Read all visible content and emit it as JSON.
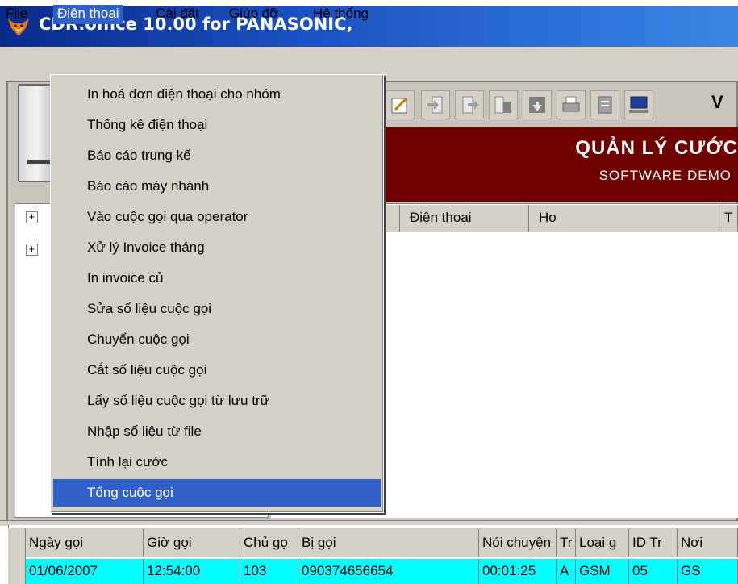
{
  "window": {
    "title": "CDR.office 10.00 for PANASONIC,"
  },
  "menubar": {
    "items": [
      {
        "label": "File"
      },
      {
        "label": "Điện thoại"
      },
      {
        "label": "Cài đặt"
      },
      {
        "label": "Giúp đỡ"
      },
      {
        "label": "Hệ thống"
      }
    ]
  },
  "dropdown": {
    "items": [
      {
        "label": "In hoá đơn điện thoại cho nhóm"
      },
      {
        "label": "Thống kê điện thoại"
      },
      {
        "label": "Báo cáo trung kế"
      },
      {
        "label": "Báo cáo máy nhánh"
      },
      {
        "label": "Vào cuộc gọi qua operator"
      },
      {
        "label": "Xử lý Invoice tháng"
      },
      {
        "label": "In invoice củ"
      },
      {
        "label": "Sửa số liệu cuộc gọi"
      },
      {
        "label": "Chuyển cuộc gọi"
      },
      {
        "label": "Cắt số liệu cuộc gọi"
      },
      {
        "label": "Lấy số liệu cuộc gọi từ lưu trữ"
      },
      {
        "label": "Nhập số liệu từ file"
      },
      {
        "label": "Tính lại cước"
      },
      {
        "label": "Tổng cuộc gọi"
      }
    ]
  },
  "toolbar": {
    "v_label": "V"
  },
  "banner": {
    "title": "QUẢN LÝ CƯỚC",
    "subtitle": "SOFTWARE DEMO"
  },
  "tree": {
    "expanders": [
      "+",
      "+"
    ]
  },
  "list": {
    "columns": [
      "Điện thoại",
      "Ho",
      "T"
    ]
  },
  "grid": {
    "columns": [
      "Ngày gọi",
      "Giờ gọi",
      "Chủ gọ",
      "Bị gọi",
      "Nói chuyện",
      "Tr",
      "Loại g",
      "ID Tr",
      "Nơi"
    ],
    "row": [
      "01/06/2007",
      "12:54:00",
      "103",
      "090374656654",
      "00:01:25",
      "A",
      "GSM",
      "05",
      "GS"
    ]
  },
  "colors": {
    "titlebar": "#1a50c0",
    "banner": "#6e0000",
    "selection": "#3060c8",
    "row_highlight": "#00ffff"
  }
}
